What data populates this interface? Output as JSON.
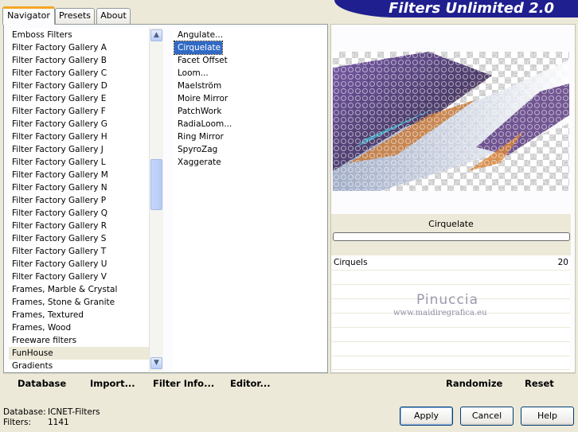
{
  "app": {
    "title": "Filters Unlimited 2.0"
  },
  "tabs": [
    "Navigator",
    "Presets",
    "About"
  ],
  "categories": [
    "Emboss Filters",
    "Filter Factory Gallery A",
    "Filter Factory Gallery B",
    "Filter Factory Gallery C",
    "Filter Factory Gallery D",
    "Filter Factory Gallery E",
    "Filter Factory Gallery F",
    "Filter Factory Gallery G",
    "Filter Factory Gallery H",
    "Filter Factory Gallery J",
    "Filter Factory Gallery L",
    "Filter Factory Gallery M",
    "Filter Factory Gallery N",
    "Filter Factory Gallery P",
    "Filter Factory Gallery Q",
    "Filter Factory Gallery R",
    "Filter Factory Gallery S",
    "Filter Factory Gallery T",
    "Filter Factory Gallery U",
    "Filter Factory Gallery V",
    "Frames, Marble & Crystal",
    "Frames, Stone & Granite",
    "Frames, Textured",
    "Frames, Wood",
    "Freeware filters",
    "FunHouse",
    "Gradients"
  ],
  "selected_category": "FunHouse",
  "filters": [
    "Angulate...",
    "Cirquelate",
    "Facet Offset",
    "Loom...",
    "Maelström",
    "Moire Mirror",
    "PatchWork",
    "RadiaLoom...",
    "Ring Mirror",
    "SpyroZag",
    "Xaggerate"
  ],
  "selected_filter": "Cirquelate",
  "preview": {
    "filter_name": "Cirquelate"
  },
  "params": [
    {
      "label": "Cirquels",
      "value": "20"
    }
  ],
  "watermark": {
    "name": "Pinuccia",
    "site": "www.maidiregrafica.eu"
  },
  "bottom_links": {
    "database": "Database",
    "import": "Import...",
    "filter_info": "Filter Info...",
    "editor": "Editor...",
    "randomize": "Randomize",
    "reset": "Reset"
  },
  "status": {
    "database_label": "Database:",
    "database_value": "ICNET-Filters",
    "filters_label": "Filters:",
    "filters_value": "1141"
  },
  "buttons": {
    "apply": "Apply",
    "cancel": "Cancel",
    "help": "Help"
  }
}
